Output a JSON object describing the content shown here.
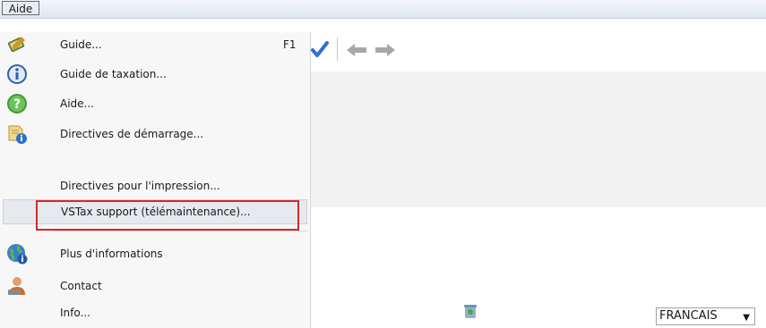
{
  "menubar": {
    "aide_label": "Aide"
  },
  "menu": {
    "items": [
      {
        "label": "Guide...",
        "shortcut": "F1",
        "icon": "book-pen-icon"
      },
      {
        "label": "Guide de taxation...",
        "icon": "info-icon"
      },
      {
        "label": "Aide...",
        "icon": "help-icon"
      },
      {
        "label": "Directives de démarrage...",
        "icon": "doc-info-icon"
      },
      {
        "label": "Directives pour l'impression...",
        "icon": ""
      },
      {
        "label": "VSTax support (télémaintenance)...",
        "icon": ""
      },
      {
        "label": "Plus d'informations",
        "icon": "globe-info-icon"
      },
      {
        "label": "Contact",
        "icon": "contact-icon"
      },
      {
        "label": "Info...",
        "icon": ""
      }
    ]
  },
  "toolbar": {
    "icons": [
      "check-icon",
      "back-arrow-icon",
      "forward-arrow-icon"
    ]
  },
  "status": {
    "language": "FRANCAIS"
  },
  "colors": {
    "highlight_box": "#d22a2a",
    "menu_bg": "#f7f7f7"
  }
}
